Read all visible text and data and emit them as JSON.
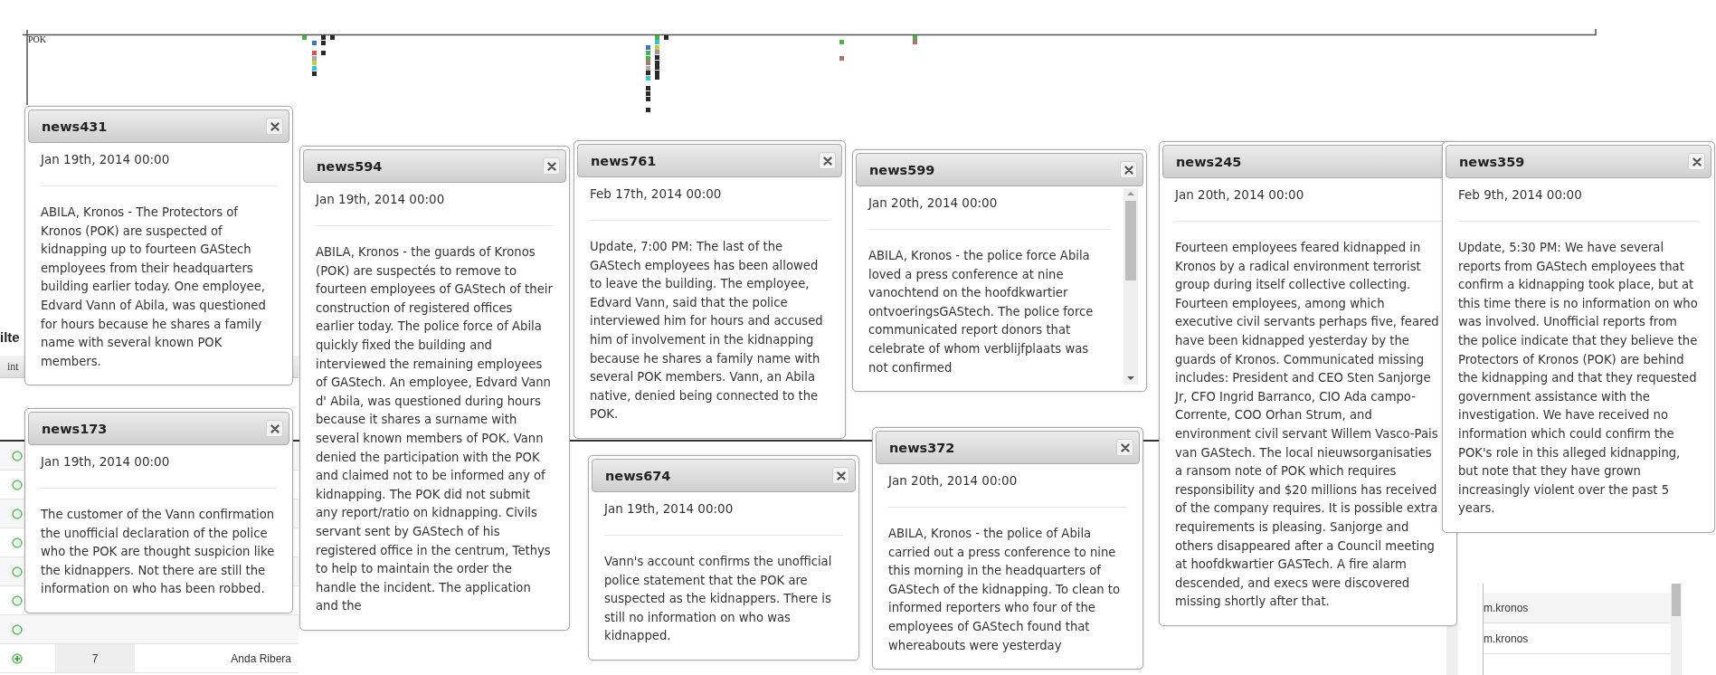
{
  "timeline": {
    "label": "POK"
  },
  "filter_panel": {
    "title": "ilte",
    "tab": "int",
    "rows": [
      {
        "column_1": "7",
        "column_2": "Anda Ribera"
      }
    ]
  },
  "right_table": {
    "rows": [
      {
        "column_1": "m.kronos"
      },
      {
        "column_1": "m.kronos"
      }
    ]
  },
  "dialogs": [
    {
      "title": "news431",
      "date": "Jan 19th, 2014 00:00",
      "closable": true,
      "scrollable": false,
      "body": "ABILA, Kronos - The Protectors of Kronos (POK) are suspected of kidnapping up to fourteen GAStech employees from their headquarters building earlier today. One employee, Edvard Vann of Abila, was questioned for hours because he shares a family name with several known POK members."
    },
    {
      "title": "news173",
      "date": "Jan 19th, 2014 00:00",
      "closable": true,
      "scrollable": false,
      "body": "The customer of the Vann confirmation the unofficial declaration of the police who the POK are thought suspicion like the kidnappers. Not there are still the information on who has been robbed."
    },
    {
      "title": "news594",
      "date": "Jan 19th, 2014 00:00",
      "closable": true,
      "scrollable": false,
      "body": "ABILA, Kronos - the guards of Kronos (POK) are suspectés to remove to fourteen employees of GAStech of their construction of registered offices earlier today. The police force of Abila quickly fixed the building and interviewed the remaining employees of GAStech. An employee, Edvard Vann d' Abila, was questioned during hours because it shares a surname with several known members of POK. Vann denied the participation with the POK and claimed not to be informed any of kidnapping. The POK did not submit any report/ratio on kidnapping. Civils servant sent by GAStech of his registered office in the centrum, Tethys to help to maintain the order the handle the incident. The application and the"
    },
    {
      "title": "news761",
      "date": "Feb 17th, 2014 00:00",
      "closable": true,
      "scrollable": false,
      "body": "Update, 7:00 PM: The last of the GAStech employees has been allowed to leave the building. The employee, Edvard Vann, said that the police interviewed him for hours and accused him of involvement in the kidnapping because he shares a family name with several POK members. Vann, an Abila native, denied being connected to the POK."
    },
    {
      "title": "news674",
      "date": "Jan 19th, 2014 00:00",
      "closable": true,
      "scrollable": false,
      "body": "Vann's account confirms the unofficial police statement that the POK are suspected as the kidnappers. There is still no information on who was kidnapped."
    },
    {
      "title": "news599",
      "date": "Jan 20th, 2014 00:00",
      "closable": true,
      "scrollable": true,
      "body": "ABILA, Kronos - the police force Abila loved a press conference at nine vanochtend on the hoofdkwartier ontvoeringsGAStech. The police force communicated report donors that celebrate of whom verblijfplaats was not confirmed"
    },
    {
      "title": "news372",
      "date": "Jan 20th, 2014 00:00",
      "closable": true,
      "scrollable": false,
      "body": "ABILA, Kronos - the police of Abila carried out a press conference to nine this morning in the headquarters of GAStech of the kidnapping. To clean to informed reporters who four of the employees of GAStech found that whereabouts were yesterday"
    },
    {
      "title": "news245",
      "date": "Jan 20th, 2014 00:00",
      "closable": false,
      "scrollable": false,
      "body": "Fourteen employees feared kidnapped in Kronos by a radical environment terrorist group during itself collective collecting. Fourteen employees, among which executive civil servants perhaps five, feared have been kidnapped yesterday by the guards of Kronos. Communicated missing includes: President and CEO Sten Sanjorge Jr, CFO Ingrid Barranco, CIO Ada campo-Corrente, COO Orhan Strum, and environment civil servant Willem Vasco-Pais van GAStech. The local nieuwsorganisaties a ransom note of POK which requires responsibility and $20 millions has received of the company requires. It is possible extra requirements is pleasing. Sanjorge and others disappeared after a Council meeting at hoofdkwartier GASTech. A fire alarm descended, and execs were discovered missing shortly after that."
    },
    {
      "title": "news359",
      "date": "Feb 9th, 2014 00:00",
      "closable": true,
      "scrollable": false,
      "body": "Update, 5:30 PM: We have several reports from GAStech employees that confirm a kidnapping took place, but at this time there is no information on who was involved. Unofficial reports from the police indicate that they believe the Protectors of Kronos (POK) are behind the kidnapping and that they requested government assistance with the investigation. We have received no information which could confirm the POK's role in this alleged kidnapping, but note that they have grown increasingly violent over the past 5 years."
    }
  ]
}
